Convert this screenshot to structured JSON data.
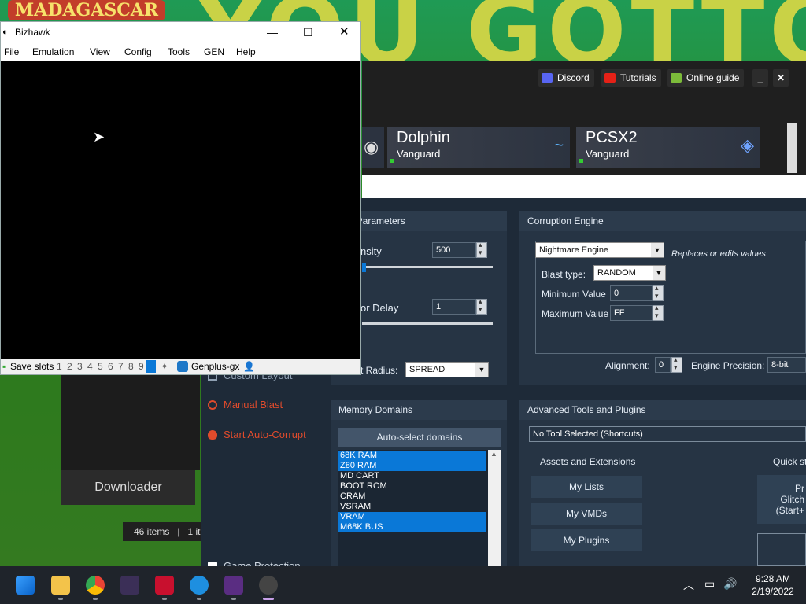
{
  "wallpaper": {
    "banner_text": "YOU GOTTO",
    "logo_text": "MADAGASCAR"
  },
  "bizhawk": {
    "title": "Bizhawk",
    "menu": [
      "File",
      "Emulation",
      "View",
      "Config",
      "Tools",
      "GEN",
      "Help"
    ],
    "status": {
      "save_slots_label": "Save slots",
      "slots": [
        "1",
        "2",
        "3",
        "4",
        "5",
        "6",
        "7",
        "8",
        "9"
      ],
      "core": "Genplus-gx"
    }
  },
  "rtc": {
    "header_buttons": {
      "discord": "Discord",
      "tutorials": "Tutorials",
      "online_guide": "Online guide"
    },
    "cards": [
      {
        "title": "Dolphin",
        "subtitle": "Vanguard"
      },
      {
        "title": "PCSX2",
        "subtitle": "Vanguard"
      }
    ],
    "general": {
      "header": "al Parameters",
      "intensity_label": "nsity",
      "intensity_value": "500",
      "delay_label": "or Delay",
      "delay_value": "1",
      "radius_label": "t Radius:",
      "radius_value": "SPREAD"
    },
    "engine": {
      "header": "Corruption Engine",
      "engine_value": "Nightmare Engine",
      "engine_desc": "Replaces or edits values",
      "blast_type_label": "Blast type:",
      "blast_type_value": "RANDOM",
      "min_label": "Minimum Value",
      "min_value": "0",
      "max_label": "Maximum Value",
      "max_value": "FF",
      "alignment_label": "Alignment:",
      "alignment_value": "0",
      "precision_label": "Engine Precision:",
      "precision_value": "8-bit"
    },
    "memory": {
      "header": "Memory Domains",
      "auto_button": "Auto-select domains",
      "domains": [
        {
          "name": "68K RAM",
          "selected": true
        },
        {
          "name": "Z80 RAM",
          "selected": true
        },
        {
          "name": "MD CART",
          "selected": false
        },
        {
          "name": "BOOT ROM",
          "selected": false
        },
        {
          "name": "CRAM",
          "selected": false
        },
        {
          "name": "VSRAM",
          "selected": false
        },
        {
          "name": "VRAM",
          "selected": true
        },
        {
          "name": "M68K BUS",
          "selected": true
        }
      ]
    },
    "advanced": {
      "header": "Advanced Tools and Plugins",
      "tool_select": "No Tool Selected (Shortcuts)",
      "assets_label": "Assets and Extensions",
      "quick_label": "Quick st",
      "buttons": [
        "My Lists",
        "My VMDs",
        "My Plugins"
      ],
      "glitch_lines": [
        "Pr",
        "Glitch",
        "(Start+"
      ]
    },
    "left_menu": {
      "custom_layout": "Custom Layout",
      "manual_blast": "Manual Blast",
      "auto_corrupt": "Start Auto-Corrupt",
      "game_protection": "Game Protection"
    }
  },
  "explorer": {
    "downloader": "Downloader",
    "items": "46 items",
    "selected": "1 ite"
  },
  "taskbar": {
    "time": "9:28 AM",
    "date": "2/19/2022"
  },
  "colors": {
    "selection": "#0a78d7",
    "accent_red": "#e04b2c"
  }
}
